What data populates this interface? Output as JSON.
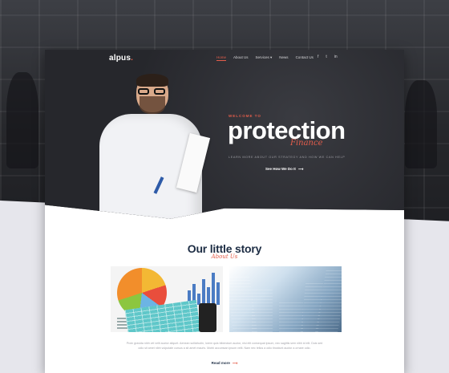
{
  "nav": {
    "logo": "alpus",
    "logo_dot": ".",
    "links": [
      "Home",
      "About Us",
      "Services ▾",
      "News",
      "Contact Us"
    ],
    "active_index": 0,
    "socials": [
      "f",
      "t",
      "in"
    ]
  },
  "hero": {
    "welcome": "WELCOME TO",
    "title": "protection",
    "script": "Finance",
    "subtitle": "LEARN MORE ABOUT OUR STRATEGY AND HOW WE CAN HELP",
    "cta": "See How We Do It",
    "cta_arrow": "⟶"
  },
  "story": {
    "title": "Our little story",
    "script": "About Us",
    "text": "Proin gravida nibh vel velit auctor aliquet. Aenean sollicitudin, lorem quis bibendum auctor, nisi elit consequat ipsum, nec sagittis sem nibh id elit. Duis sed odio sit amet nibh vulputate cursus a sit amet mauris. Morbi accumsan ipsum velit. Nam nec tellus a odio tincidunt auctor a ornare odio.",
    "read_more": "Read more",
    "read_more_arrow": "⟶"
  },
  "colors": {
    "accent": "#e35d4b",
    "dark": "#2a2b30",
    "heading": "#1d2d44"
  }
}
